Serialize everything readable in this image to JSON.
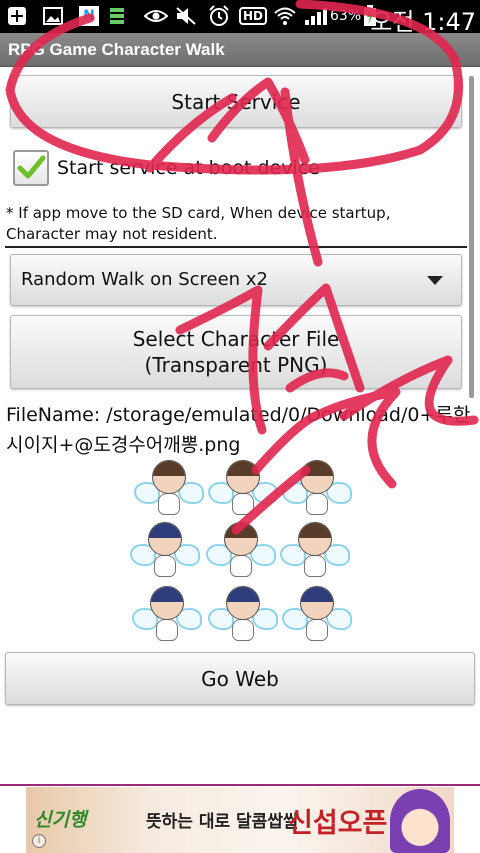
{
  "status_bar": {
    "icons": [
      "plus-icon",
      "image-icon",
      "naver-n-icon",
      "bars-icon",
      "eye-icon",
      "mute-icon",
      "alarm-icon",
      "hd-icon",
      "wifi-icon",
      "signal-icon",
      "battery-charging-icon"
    ],
    "naver_letter": "N",
    "hd_label": "HD",
    "battery": "63%",
    "time": "오전 1:47"
  },
  "app": {
    "title": "RPG Game Character Walk"
  },
  "controls": {
    "start_service_label": "Start Service",
    "start_on_boot_label": "Start service at boot device",
    "start_on_boot_checked": true,
    "note": "* If app move to the SD card, When device startup, Character may not resident.",
    "walk_mode_selected": "Random Walk on Screen x2",
    "select_file_line1": "Select Character File",
    "select_file_line2": "(Transparent PNG)",
    "filename_text": "FileName: /storage/emulated/0/Download/0+루한시이지+@도경수어깨뽕.png",
    "go_web_label": "Go Web"
  },
  "ad": {
    "brand": "신기행",
    "copy": "뜻하는 대로 달콤쌉쌀",
    "headline": "신섭오픈",
    "info": "i"
  },
  "colors": {
    "accent_check": "#6cc02a",
    "scribble": "#e0274f",
    "ad_border": "#9b2a78"
  }
}
